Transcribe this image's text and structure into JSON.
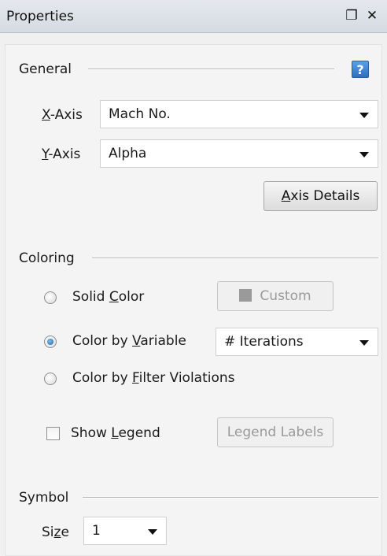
{
  "window": {
    "title": "Properties",
    "float_icon": "restore-icon",
    "close_icon": "close-icon"
  },
  "general": {
    "label": "General",
    "help_icon": "help-icon",
    "x_axis": {
      "label_pre": "",
      "label_u": "X",
      "label_post": "-Axis",
      "value": "Mach No."
    },
    "y_axis": {
      "label_pre": "",
      "label_u": "Y",
      "label_post": "-Axis",
      "value": "Alpha"
    },
    "axis_details": {
      "pre": "",
      "u": "A",
      "post": "xis Details"
    }
  },
  "coloring": {
    "label": "Coloring",
    "solid": {
      "pre": "Solid ",
      "u": "C",
      "post": "olor",
      "checked": false
    },
    "custom_button": "Custom",
    "by_variable": {
      "pre": "Color by ",
      "u": "V",
      "post": "ariable",
      "checked": true,
      "value": "# Iterations"
    },
    "by_filter": {
      "pre": "Color by ",
      "u": "F",
      "post": "ilter Violations",
      "checked": false
    },
    "show_legend": {
      "pre": "Show ",
      "u": "L",
      "post": "egend",
      "checked": false
    },
    "legend_labels": {
      "pre": "Le",
      "u": "g",
      "post": "end Labels"
    }
  },
  "symbol": {
    "label": "Symbol",
    "size": {
      "pre": "Si",
      "u": "z",
      "post": "e",
      "value": "1"
    }
  }
}
